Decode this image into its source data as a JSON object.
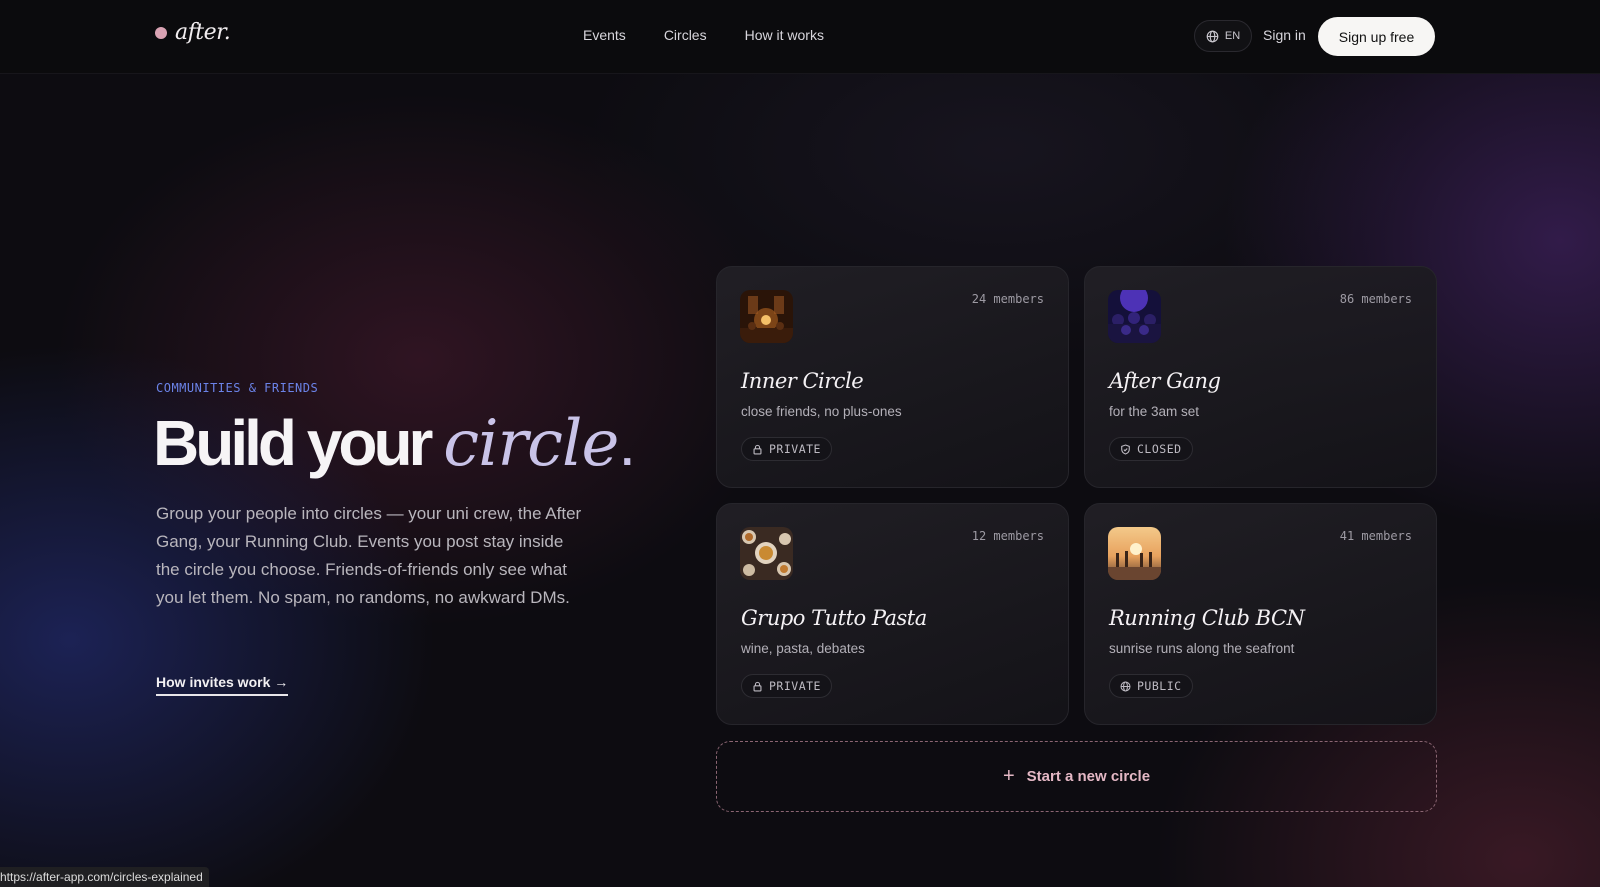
{
  "nav": {
    "logo": "after.",
    "links": [
      "Events",
      "Circles",
      "How it works"
    ],
    "lang": "EN",
    "signin": "Sign in",
    "signup": "Sign up free"
  },
  "hero": {
    "eyebrow": "COMMUNITIES & FRIENDS",
    "headline_plain": "Build your",
    "headline_accent": "circle",
    "headline_period": ".",
    "lede": "Group your people into circles — your uni crew, the After Gang, your Running Club. Events you post stay inside the circle you choose. Friends-of-friends only see what you let them. No spam, no randoms, no awkward DMs.",
    "cta": "How invites work →"
  },
  "circles": [
    {
      "title": "Inner Circle",
      "subtitle": "close friends, no plus-ones",
      "members": "24 members",
      "badge": "PRIVATE",
      "badge_icon": "lock-icon"
    },
    {
      "title": "After Gang",
      "subtitle": "for the 3am set",
      "members": "86 members",
      "badge": "CLOSED",
      "badge_icon": "shield-icon"
    },
    {
      "title": "Grupo Tutto Pasta",
      "subtitle": "wine, pasta, debates",
      "members": "12 members",
      "badge": "PRIVATE",
      "badge_icon": "lock-icon"
    },
    {
      "title": "Running Club BCN",
      "subtitle": "sunrise runs along the seafront",
      "members": "41 members",
      "badge": "PUBLIC",
      "badge_icon": "globe-icon"
    }
  ],
  "new_circle": "Start a new circle",
  "status_url": "https://after-app.com/circles-explained",
  "colors": {
    "accent_pink": "#e4b8c5",
    "eyebrow_blue": "#6b83e8",
    "headline_accent": "#c9c3e8"
  }
}
